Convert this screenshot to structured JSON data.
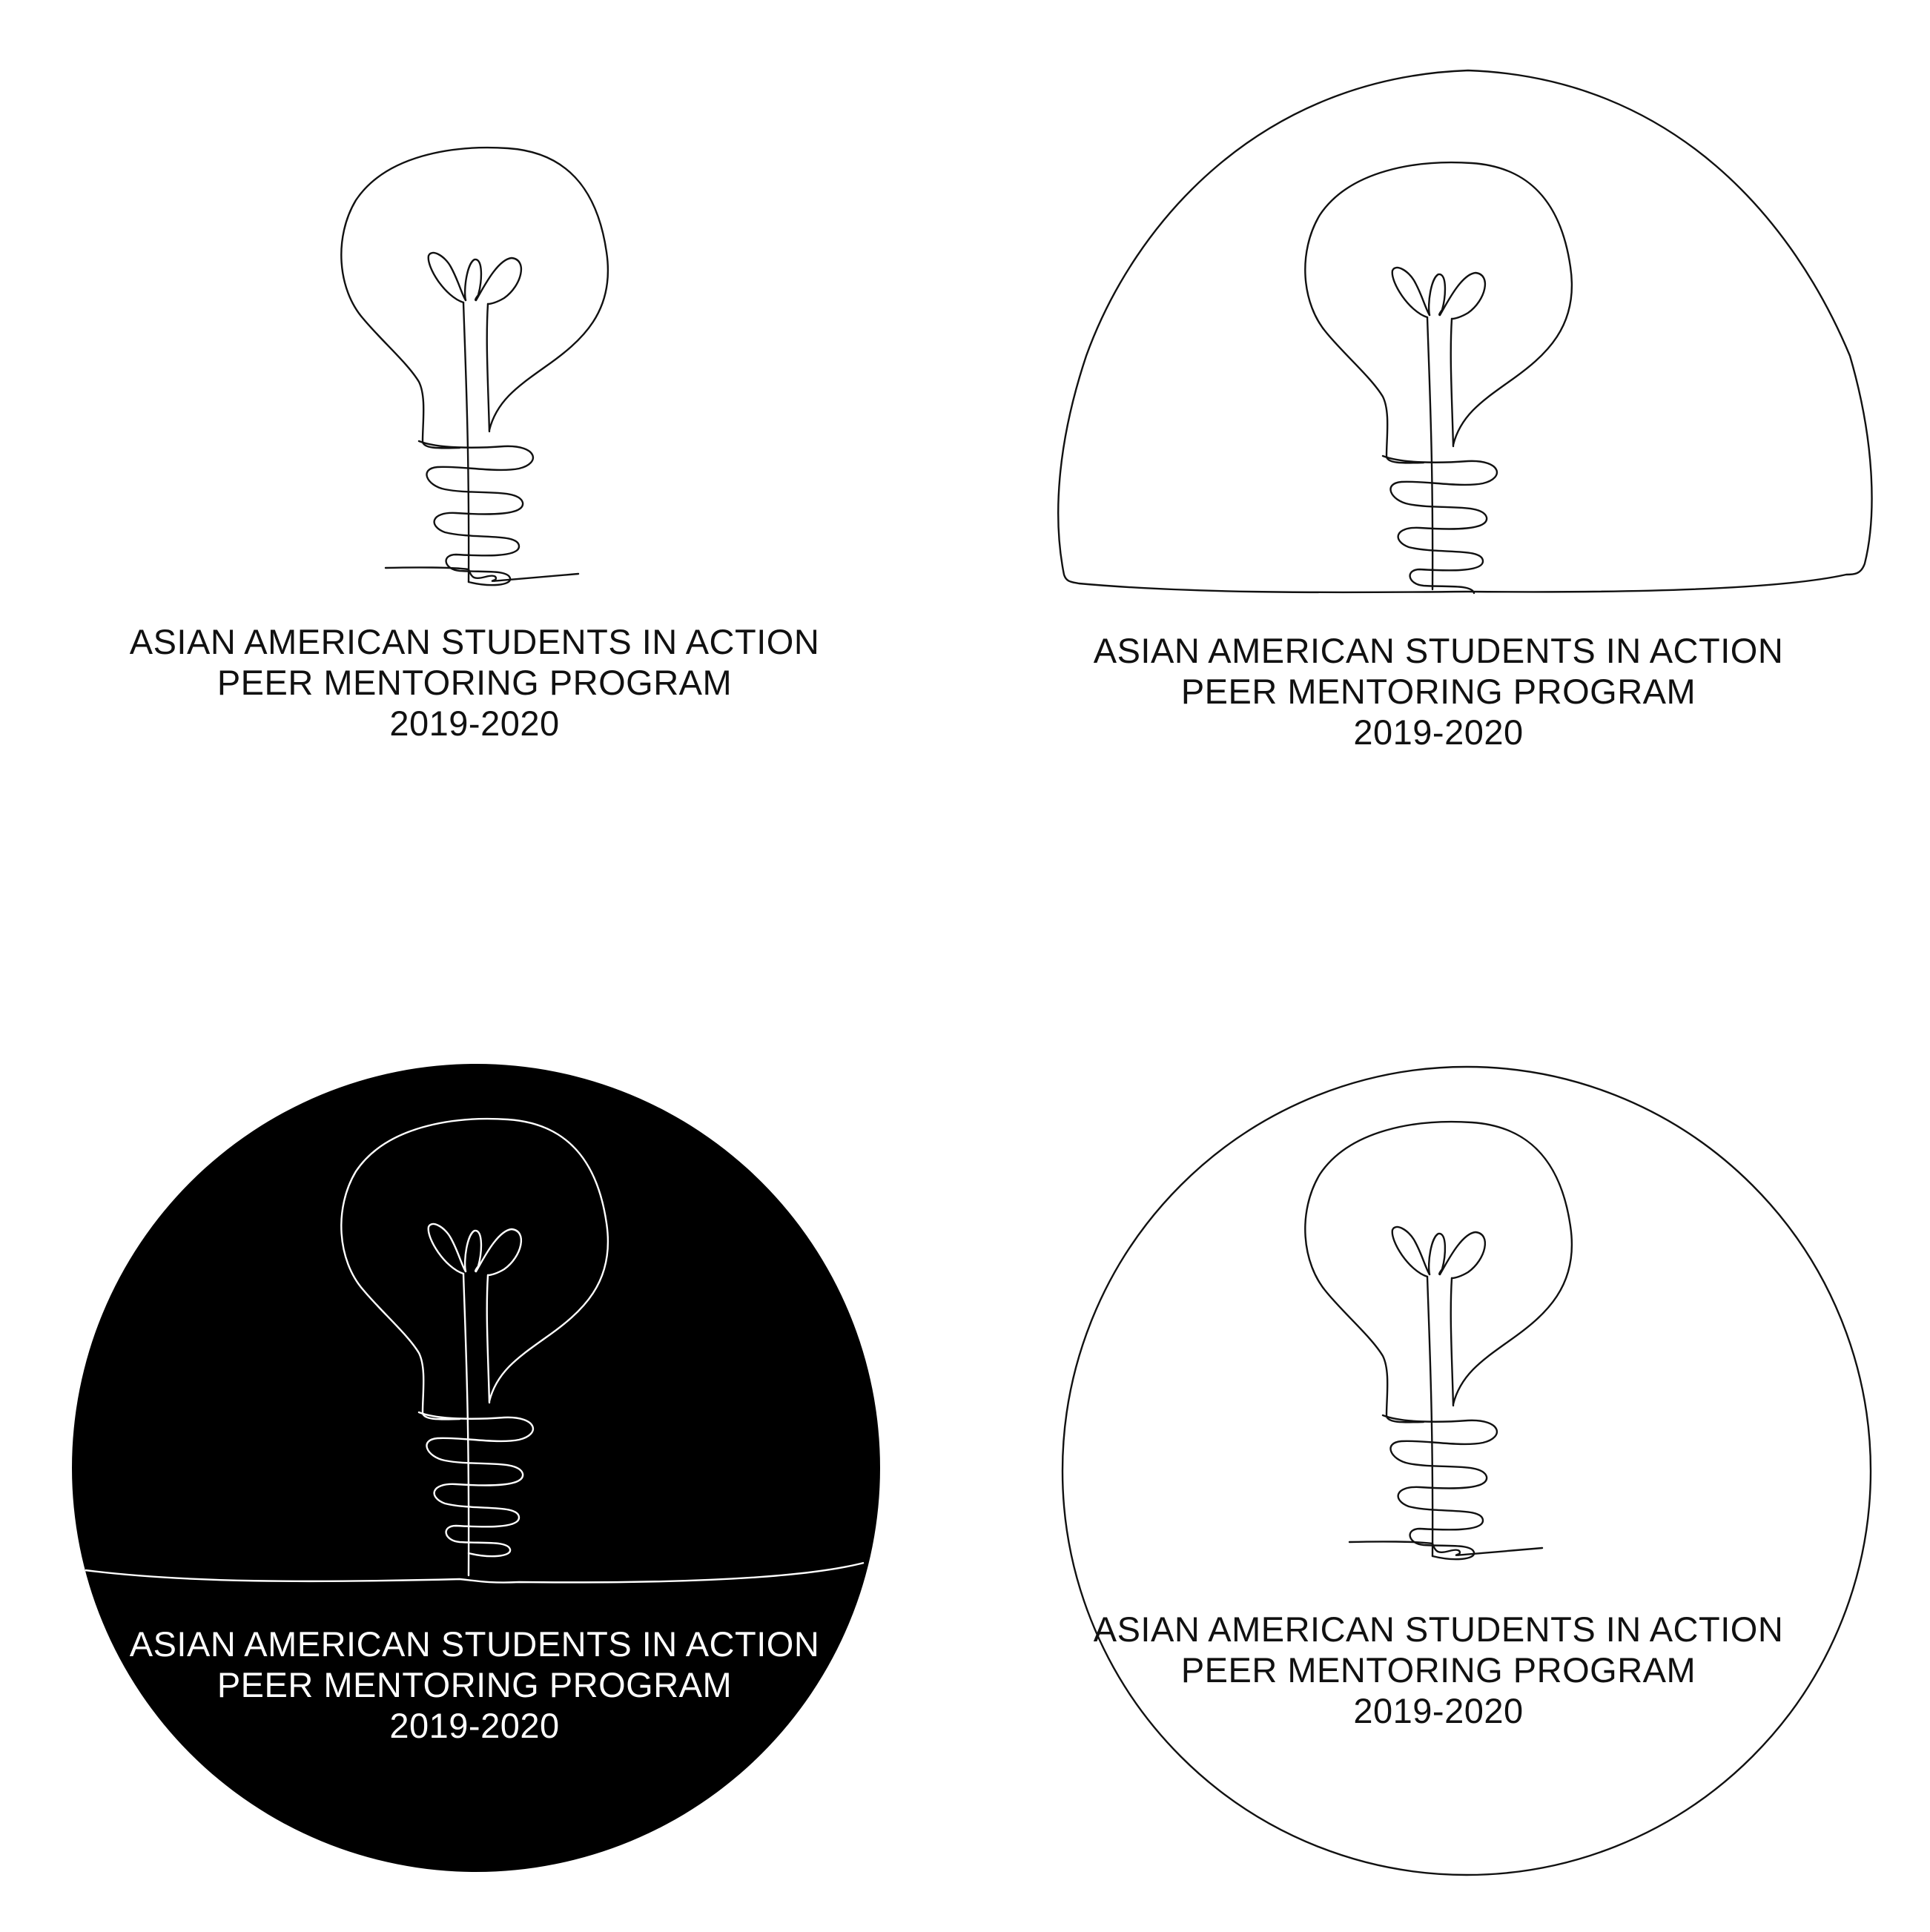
{
  "logo_variants": [
    {
      "style": "plain",
      "caption": {
        "line1": "ASIAN AMERICAN STUDENTS IN ACTION",
        "line2": "PEER MENTORING PROGRAM",
        "line3": "2019-2020"
      }
    },
    {
      "style": "dome-outline",
      "caption": {
        "line1": "ASIAN AMERICAN STUDENTS IN ACTION",
        "line2": "PEER MENTORING PROGRAM",
        "line3": "2019-2020"
      }
    },
    {
      "style": "black-circle",
      "caption": {
        "line1": "ASIAN AMERICAN STUDENTS IN ACTION",
        "line2": "PEER MENTORING PROGRAM",
        "line3": "2019-2020"
      }
    },
    {
      "style": "circle-outline",
      "caption": {
        "line1": "ASIAN AMERICAN STUDENTS IN ACTION",
        "line2": "PEER MENTORING PROGRAM",
        "line3": "2019-2020"
      }
    }
  ],
  "icons": {
    "main": "lightbulb-icon"
  },
  "colors": {
    "background": "#ffffff",
    "ink": "#111111",
    "inverse_fill": "#000000",
    "inverse_ink": "#ffffff"
  }
}
